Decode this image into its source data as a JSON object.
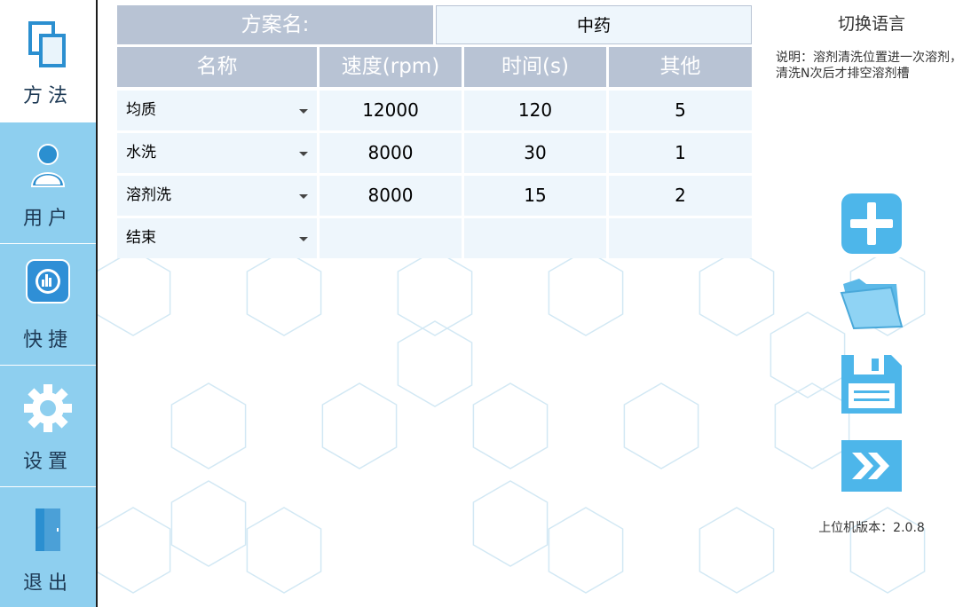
{
  "sidebar": {
    "items": [
      {
        "label": "方法",
        "icon": "method-icon"
      },
      {
        "label": "用户",
        "icon": "user-icon"
      },
      {
        "label": "快捷",
        "icon": "shortcut-icon"
      },
      {
        "label": "设置",
        "icon": "settings-gear-icon"
      },
      {
        "label": "退出",
        "icon": "exit-door-icon"
      }
    ],
    "active_index": 0
  },
  "scheme": {
    "label": "方案名:",
    "value": "中药"
  },
  "table": {
    "headers": [
      "名称",
      "速度(rpm)",
      "时间(s)",
      "其他"
    ],
    "rows": [
      {
        "name": "均质",
        "speed": "12000",
        "time": "120",
        "other": "5"
      },
      {
        "name": "水洗",
        "speed": "8000",
        "time": "30",
        "other": "1"
      },
      {
        "name": "溶剂洗",
        "speed": "8000",
        "time": "15",
        "other": "2"
      },
      {
        "name": "结束",
        "speed": "",
        "time": "",
        "other": ""
      }
    ]
  },
  "right_panel": {
    "language_button": "切换语言",
    "note": "说明：溶剂清洗位置进一次溶剂，清洗N次后才排空溶剂槽",
    "actions": [
      {
        "name": "add",
        "icon": "plus-icon"
      },
      {
        "name": "open",
        "icon": "folder-icon"
      },
      {
        "name": "save",
        "icon": "save-floppy-icon"
      },
      {
        "name": "next",
        "icon": "double-chevron-right-icon"
      }
    ],
    "version": "上位机版本：2.0.8"
  },
  "colors": {
    "sidebar_bg": "#8ecfef",
    "header_bg": "#b8c3d4",
    "cell_bg": "#eef6fc",
    "icon_blue": "#4db6ea"
  }
}
